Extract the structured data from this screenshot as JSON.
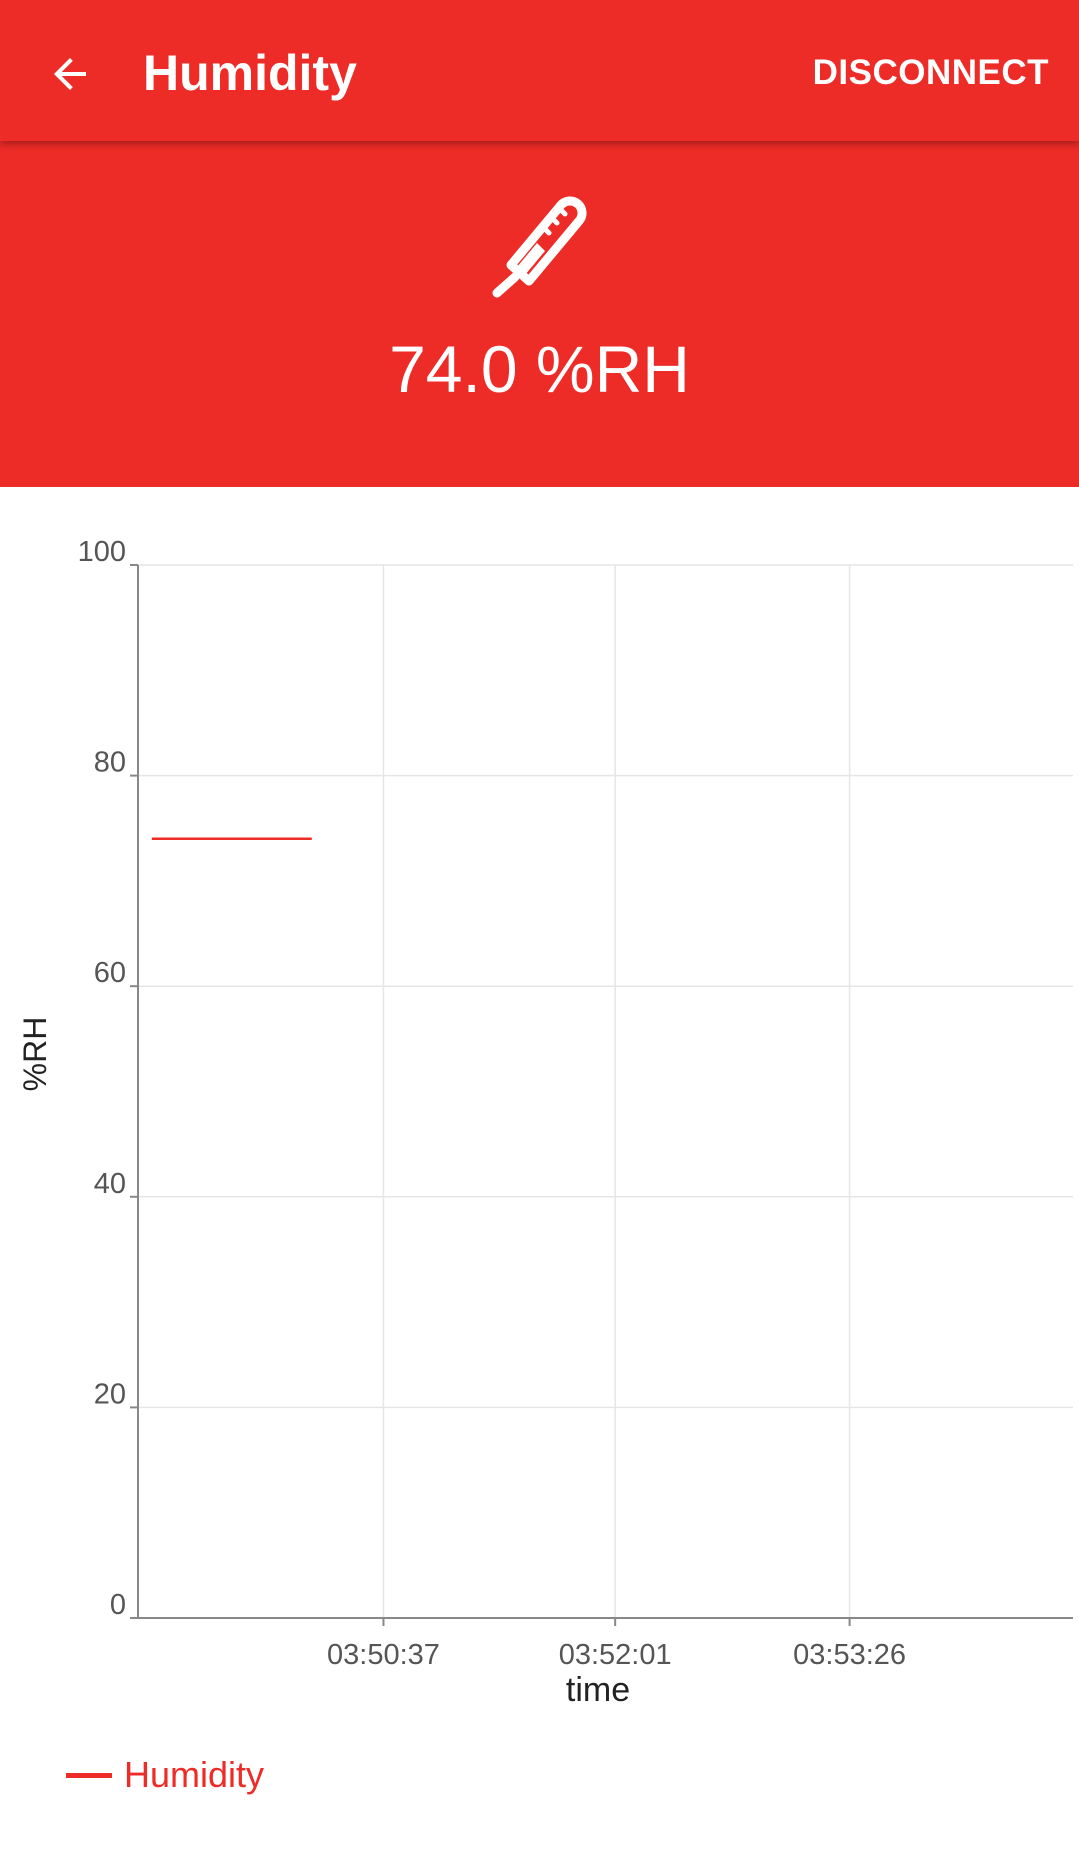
{
  "appbar": {
    "title": "Humidity",
    "back_icon": "arrow-left-icon",
    "disconnect_label": "DISCONNECT"
  },
  "header": {
    "icon": "thermometer-icon",
    "reading": "74.0 %RH"
  },
  "colors": {
    "accent": "#ED2B27",
    "grid": "#E6E6E6",
    "axis": "#888888",
    "text": "#222222"
  },
  "chart_data": {
    "type": "line",
    "ylabel": "%RH",
    "xlabel": "time",
    "ylim": [
      0,
      100
    ],
    "yticks": [
      0,
      20,
      40,
      60,
      80,
      100
    ],
    "xticks": [
      "03:50:37",
      "03:52:01",
      "03:53:26"
    ],
    "xlim": [
      "03:49:08",
      "03:54:47"
    ],
    "grid": true,
    "legend_position": "bottom-left",
    "series": [
      {
        "name": "Humidity",
        "color": "#ED2B27",
        "points": [
          {
            "x": "03:49:13",
            "y": 74.0
          },
          {
            "x": "03:50:11",
            "y": 74.0
          }
        ]
      }
    ]
  }
}
